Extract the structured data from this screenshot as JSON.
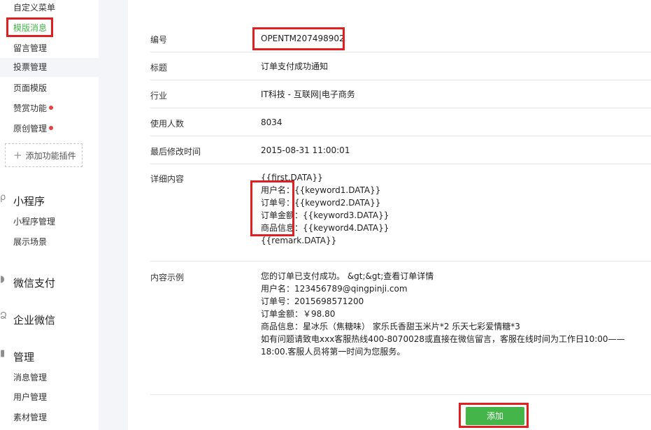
{
  "sidebar": {
    "items": [
      {
        "label": "自定义菜单"
      },
      {
        "label": "模版消息"
      },
      {
        "label": "留言管理"
      },
      {
        "label": "投票管理"
      },
      {
        "label": "页面模版"
      },
      {
        "label": "赞赏功能"
      },
      {
        "label": "原创管理"
      }
    ],
    "add_plugin": "添加功能插件",
    "groups": [
      {
        "title": "小程序",
        "icon": "mini-program-icon",
        "items": [
          {
            "label": "小程序管理"
          },
          {
            "label": "展示场景"
          }
        ]
      },
      {
        "title": "微信支付",
        "icon": "wechat-pay-icon",
        "items": []
      },
      {
        "title": "企业微信",
        "icon": "work-wechat-icon",
        "items": []
      },
      {
        "title": "管理",
        "icon": "manage-icon",
        "items": [
          {
            "label": "消息管理"
          },
          {
            "label": "用户管理"
          },
          {
            "label": "素材管理"
          }
        ]
      }
    ]
  },
  "template": {
    "fields": {
      "id": {
        "label": "编号",
        "value": "OPENTM207498902"
      },
      "title": {
        "label": "标题",
        "value": "订单支付成功通知"
      },
      "industry": {
        "label": "行业",
        "value": "IT科技 - 互联网|电子商务"
      },
      "users": {
        "label": "使用人数",
        "value": "8034"
      },
      "modified": {
        "label": "最后修改时间",
        "value": "2015-08-31 11:00:01"
      }
    },
    "detail": {
      "label": "详细内容",
      "lines": [
        "{{first.DATA}}",
        "用户名：{{keyword1.DATA}}",
        "订单号：{{keyword2.DATA}}",
        "订单金额：{{keyword3.DATA}}",
        "商品信息：{{keyword4.DATA}}",
        "{{remark.DATA}}"
      ]
    },
    "example": {
      "label": "内容示例",
      "lines": [
        "您的订单已支付成功。 &gt;&gt;查看订单详情",
        "用户名：123456789@qingpinji.com",
        "订单号：2015698571200",
        "订单金额：￥98.80",
        "商品信息：星冰乐（焦糖味）  家乐氏香甜玉米片*2  乐天七彩爱情糖*3",
        "如有问题请致电xxx客服热线400-8070028或直接在微信留言，客服在线时间为工作日10:00——",
        "18:00.客服人员将第一时间为您服务。"
      ]
    }
  },
  "actions": {
    "add_label": "添加"
  },
  "colors": {
    "accent": "#44b549",
    "highlight": "#e02020",
    "notice_dot": "#e64340"
  }
}
